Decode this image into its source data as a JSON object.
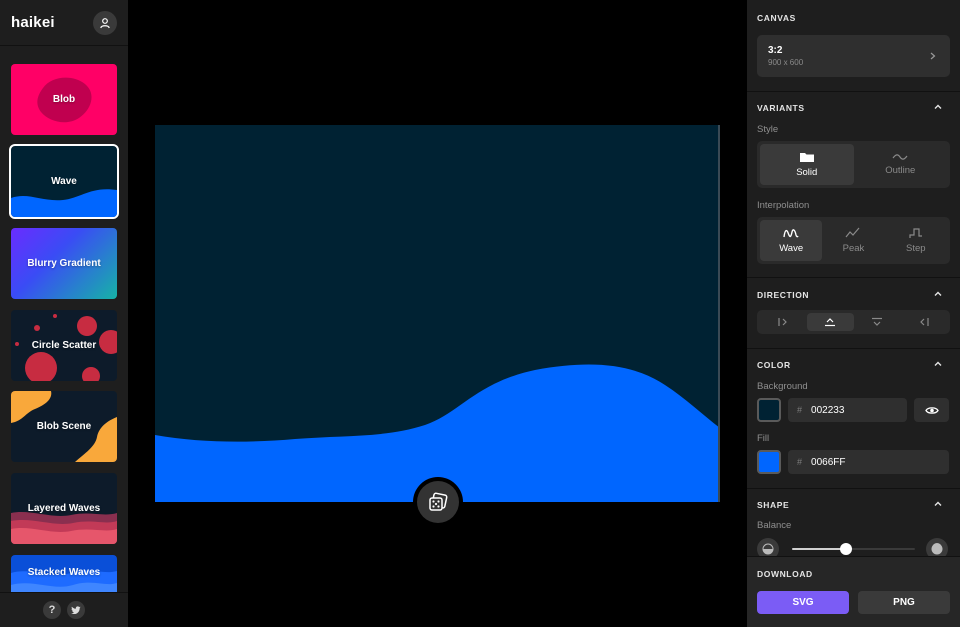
{
  "app": {
    "logo": "haikei"
  },
  "sidebar": {
    "thumbnails": [
      {
        "label": "Blob",
        "bg": "#FF0066",
        "shape": "#C0004F"
      },
      {
        "label": "Wave",
        "bg": "#002233",
        "shape": "#0066FF",
        "selected": true
      },
      {
        "label": "Blurry Gradient"
      },
      {
        "label": "Circle Scatter",
        "bg": "#0D1B2A",
        "shape": "#C72C41"
      },
      {
        "label": "Blob Scene",
        "bg": "#0D1B2A",
        "shape": "#F9A83B"
      },
      {
        "label": "Layered Waves",
        "bg": "#0D1B2A",
        "shape": "#E0475E"
      },
      {
        "label": "Stacked Waves",
        "bg": "#0066FF",
        "shape": "#3388FF"
      }
    ],
    "footer": {
      "help_label": "?"
    }
  },
  "canvas": {
    "background": "#002233",
    "fill": "#0066FF"
  },
  "panel": {
    "canvas": {
      "title": "CANVAS",
      "aspect": "3:2",
      "size": "900 x 600"
    },
    "variants": {
      "title": "VARIANTS",
      "style_label": "Style",
      "style_options": [
        {
          "label": "Solid",
          "active": true
        },
        {
          "label": "Outline",
          "active": false
        }
      ],
      "interpolation_label": "Interpolation",
      "interpolation_options": [
        {
          "label": "Wave",
          "active": true
        },
        {
          "label": "Peak",
          "active": false
        },
        {
          "label": "Step",
          "active": false
        }
      ]
    },
    "direction": {
      "title": "DIRECTION",
      "selected": "up"
    },
    "color": {
      "title": "COLOR",
      "background_label": "Background",
      "background_hex": "002233",
      "background_color": "#002233",
      "fill_label": "Fill",
      "fill_hex": "0066FF",
      "fill_color": "#0066FF"
    },
    "shape": {
      "title": "SHAPE",
      "balance_label": "Balance",
      "balance_value": 0.44
    },
    "download": {
      "title": "DOWNLOAD",
      "svg_label": "SVG",
      "png_label": "PNG"
    }
  }
}
